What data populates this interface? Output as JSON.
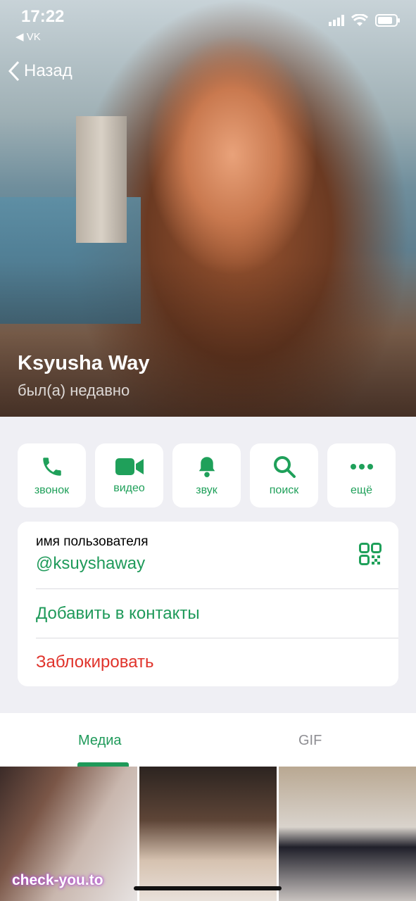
{
  "status_bar": {
    "time": "17:22",
    "back_app": "◀ VK"
  },
  "nav": {
    "back_label": "Назад"
  },
  "profile": {
    "name": "Ksyusha Way",
    "status": "был(а) недавно"
  },
  "actions": [
    {
      "label": "звонок",
      "icon": "phone-icon"
    },
    {
      "label": "видео",
      "icon": "video-icon"
    },
    {
      "label": "звук",
      "icon": "bell-icon"
    },
    {
      "label": "поиск",
      "icon": "search-icon"
    },
    {
      "label": "ещё",
      "icon": "more-icon"
    }
  ],
  "info": {
    "username_title": "имя пользователя",
    "username_value": "@ksuyshaway",
    "add_contact": "Добавить в контакты",
    "block": "Заблокировать"
  },
  "tabs": {
    "media": "Медиа",
    "gif": "GIF"
  },
  "watermark": "check-you.to",
  "colors": {
    "accent": "#1f9a5a",
    "danger": "#e0332b",
    "background": "#efeff4"
  }
}
